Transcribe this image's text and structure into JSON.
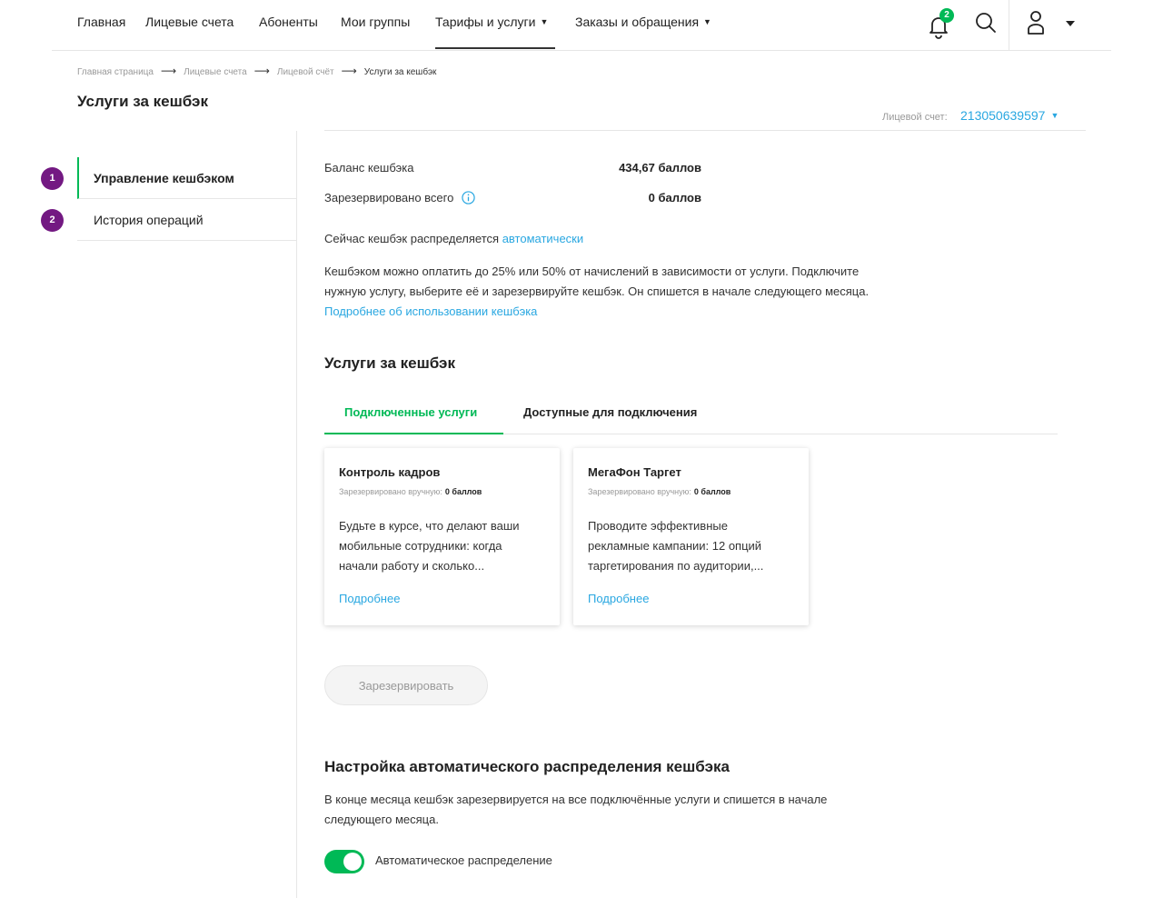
{
  "nav": {
    "items": [
      {
        "label": "Главная"
      },
      {
        "label": "Лицевые счета"
      },
      {
        "label": "Абоненты"
      },
      {
        "label": "Мои группы"
      },
      {
        "label": "Тарифы и услуги",
        "dropdown": true
      },
      {
        "label": "Заказы и обращения",
        "dropdown": true
      }
    ],
    "active_item": "Тарифы и услуги",
    "notification_count": "2",
    "icons": [
      "bell-icon",
      "search-icon",
      "user-icon",
      "caret-down-icon"
    ]
  },
  "breadcrumb": {
    "items": [
      "Главная страница",
      "Лицевые счета",
      "Лицевой счёт"
    ],
    "current": "Услуги за кешбэк"
  },
  "page": {
    "title": "Услуги за кешбэк",
    "account_label": "Лицевой счет:",
    "account_number": "213050639597"
  },
  "sidebar": {
    "items": [
      {
        "step": "1",
        "label": "Управление кешбэком",
        "active": true
      },
      {
        "step": "2",
        "label": "История операций",
        "active": false
      }
    ]
  },
  "balance": {
    "balance_label": "Баланс кешбэка",
    "balance_value": "434,67 баллов",
    "reserved_label": "Зарезервировано всего",
    "reserved_value": "0 баллов"
  },
  "distribution": {
    "prefix": "Сейчас кешбэк распределяется",
    "mode_link": "автоматически"
  },
  "info": {
    "line1": "Кешбэком можно оплатить до 25% или 50% от начислений в зависимости от услуги. Подключите",
    "line2": "нужную услугу, выберите её и зарезервируйте кешбэк. Он спишется в начале следующего месяца.",
    "more_link": "Подробнее об использовании кешбэка"
  },
  "services": {
    "title": "Услуги за кешбэк",
    "tabs": [
      {
        "label": "Подключенные услуги",
        "active": true
      },
      {
        "label": "Доступные для подключения",
        "active": false
      }
    ],
    "cards": [
      {
        "title": "Контроль кадров",
        "reserved_label": "Зарезервировано вручную:",
        "reserved_value": "0 баллов",
        "desc_lines": [
          "Будьте в курсе, что делают ваши",
          "мобильные сотрудники: когда",
          "начали работу и сколько..."
        ],
        "more_link": "Подробнее"
      },
      {
        "title": "МегаФон Таргет",
        "reserved_label": "Зарезервировано вручную:",
        "reserved_value": "0 баллов",
        "desc_lines": [
          "Проводите эффективные",
          "рекламные кампании: 12 опций",
          "таргетирования по аудитории,..."
        ],
        "more_link": "Подробнее"
      }
    ],
    "reserve_button": "Зарезервировать"
  },
  "auto": {
    "title": "Настройка автоматического распределения кешбэка",
    "desc_line1": "В конце месяца кешбэк зарезервируется на все подключённые услуги и спишется в начале",
    "desc_line2": "следующего месяца.",
    "toggle_label": "Автоматическое распределение",
    "toggle_on": true
  },
  "colors": {
    "accent_green": "#00b956",
    "accent_purple": "#731982",
    "link_blue": "#29a7e1"
  }
}
